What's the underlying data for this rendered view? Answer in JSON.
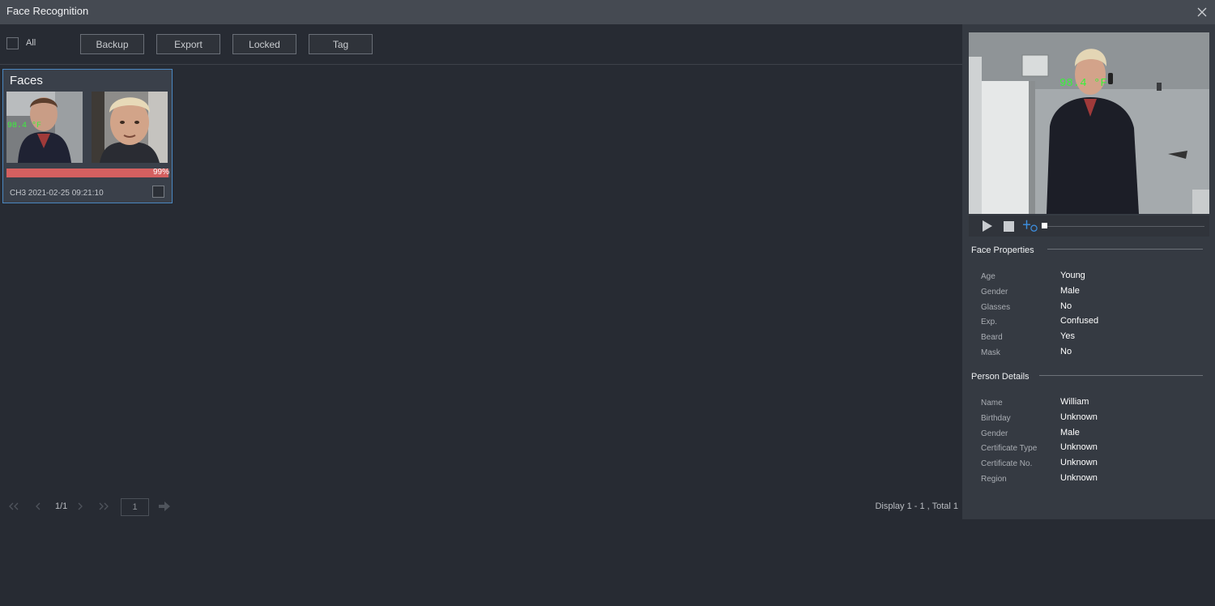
{
  "window": {
    "title": "Face Recognition"
  },
  "toolbar": {
    "all_label": "All",
    "buttons": [
      "Backup",
      "Export",
      "Locked",
      "Tag"
    ]
  },
  "card": {
    "title": "Faces",
    "similarity": 0.99,
    "similarity_label": "99%",
    "meta": "CH3 2021-02-25 09:21:10",
    "overlay_text": "98.4 °F"
  },
  "pager": {
    "page_indicator": "1/1",
    "page_input": "1",
    "display_info": "Display 1 - 1 , Total 1"
  },
  "video": {
    "overlay_text": "98.4 °F"
  },
  "face_properties": {
    "heading": "Face Properties",
    "rows": [
      {
        "label": "Age",
        "value": "Young"
      },
      {
        "label": "Gender",
        "value": "Male"
      },
      {
        "label": "Glasses",
        "value": "No"
      },
      {
        "label": "Exp.",
        "value": "Confused"
      },
      {
        "label": "Beard",
        "value": "Yes"
      },
      {
        "label": "Mask",
        "value": "No"
      }
    ]
  },
  "person_details": {
    "heading": "Person Details",
    "rows": [
      {
        "label": "Name",
        "value": "William"
      },
      {
        "label": "Birthday",
        "value": "Unknown"
      },
      {
        "label": "Gender",
        "value": "Male"
      },
      {
        "label": "Certificate Type",
        "value": "Unknown"
      },
      {
        "label": "Certificate No.",
        "value": "Unknown"
      },
      {
        "label": "Region",
        "value": "Unknown"
      }
    ]
  },
  "colors": {
    "accent": "#4a87c0",
    "progress": "#d46060",
    "overlay_text": "#3cf03c",
    "active_tool": "#3d8fe0"
  },
  "icons": {
    "close": "close-icon",
    "play": "play-icon",
    "stop": "stop-icon",
    "tool": "crosshair-tool-icon"
  }
}
